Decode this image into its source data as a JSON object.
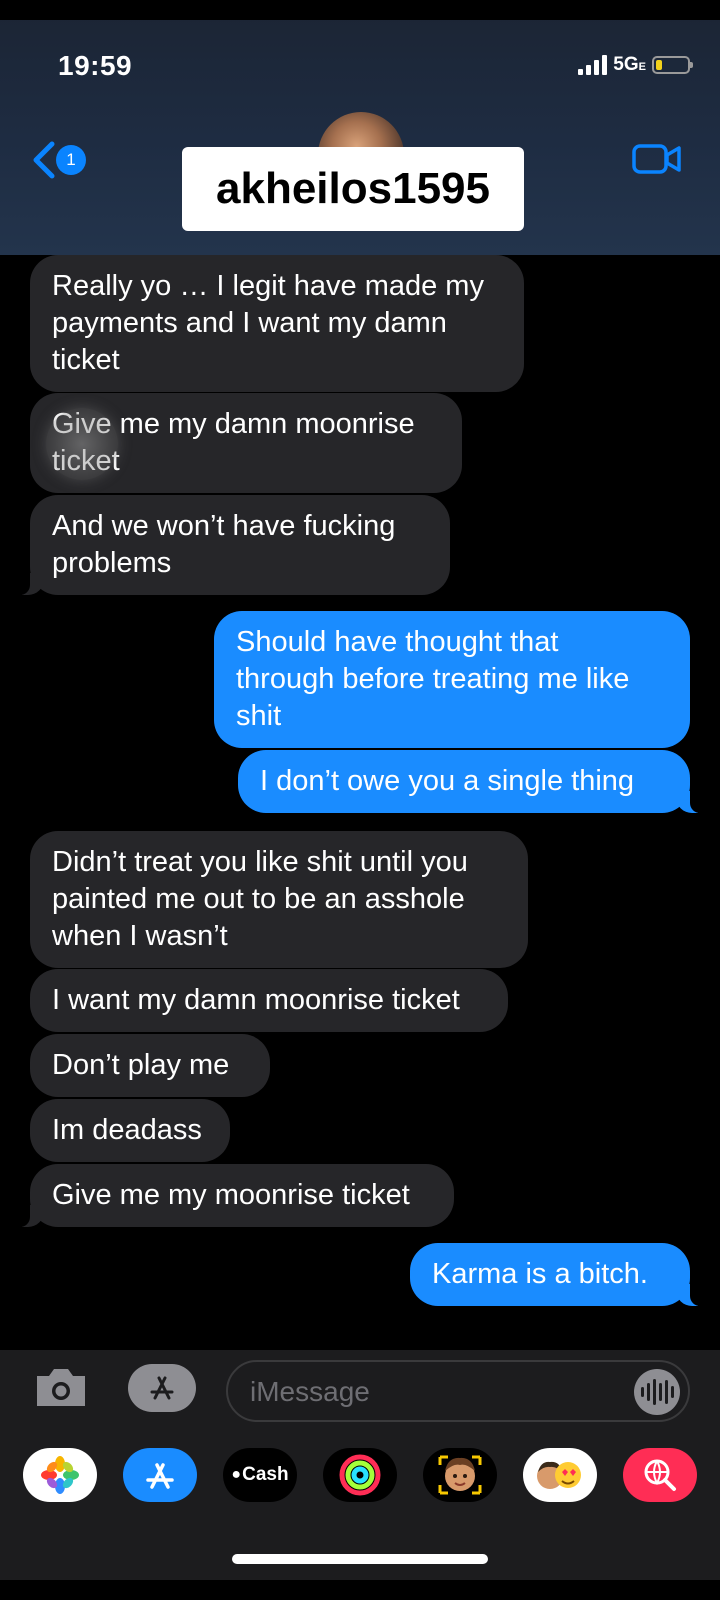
{
  "status_bar": {
    "time": "19:59",
    "network": "5G",
    "network_suffix": "E"
  },
  "header": {
    "back_badge": "1",
    "contact_name": "akheilos1595"
  },
  "messages": [
    {
      "dir": "in",
      "text": "Really yo … I legit have made my\npayments and I want my damn\nticket"
    },
    {
      "dir": "in",
      "text": "Give me my damn moonrise\nticket"
    },
    {
      "dir": "in",
      "text": "And we won’t have fucking\nproblems"
    },
    {
      "dir": "out",
      "text": "Should have thought that\nthrough before treating me like\nshit"
    },
    {
      "dir": "out",
      "text": "I don’t owe you a single thing"
    },
    {
      "dir": "in",
      "text": "Didn’t treat you like shit until you\npainted me out to be an asshole\nwhen I wasn’t"
    },
    {
      "dir": "in",
      "text": "I want my damn moonrise ticket"
    },
    {
      "dir": "in",
      "text": "Don’t play me"
    },
    {
      "dir": "in",
      "text": "Im deadass"
    },
    {
      "dir": "in",
      "text": "Give me my moonrise ticket"
    },
    {
      "dir": "out",
      "text": "Karma is a bitch."
    }
  ],
  "input": {
    "placeholder": "iMessage"
  },
  "app_drawer": [
    {
      "name": "photos-app",
      "label": ""
    },
    {
      "name": "app-store-app",
      "label": ""
    },
    {
      "name": "cash-app",
      "label": "Cash"
    },
    {
      "name": "activity-app",
      "label": ""
    },
    {
      "name": "memoji-app",
      "label": ""
    },
    {
      "name": "animoji-stickers-app",
      "label": ""
    },
    {
      "name": "web-images-app",
      "label": ""
    }
  ],
  "colors": {
    "incoming_bubble": "#262629",
    "outgoing_bubble": "#1a8cff",
    "accent": "#0a84ff"
  }
}
